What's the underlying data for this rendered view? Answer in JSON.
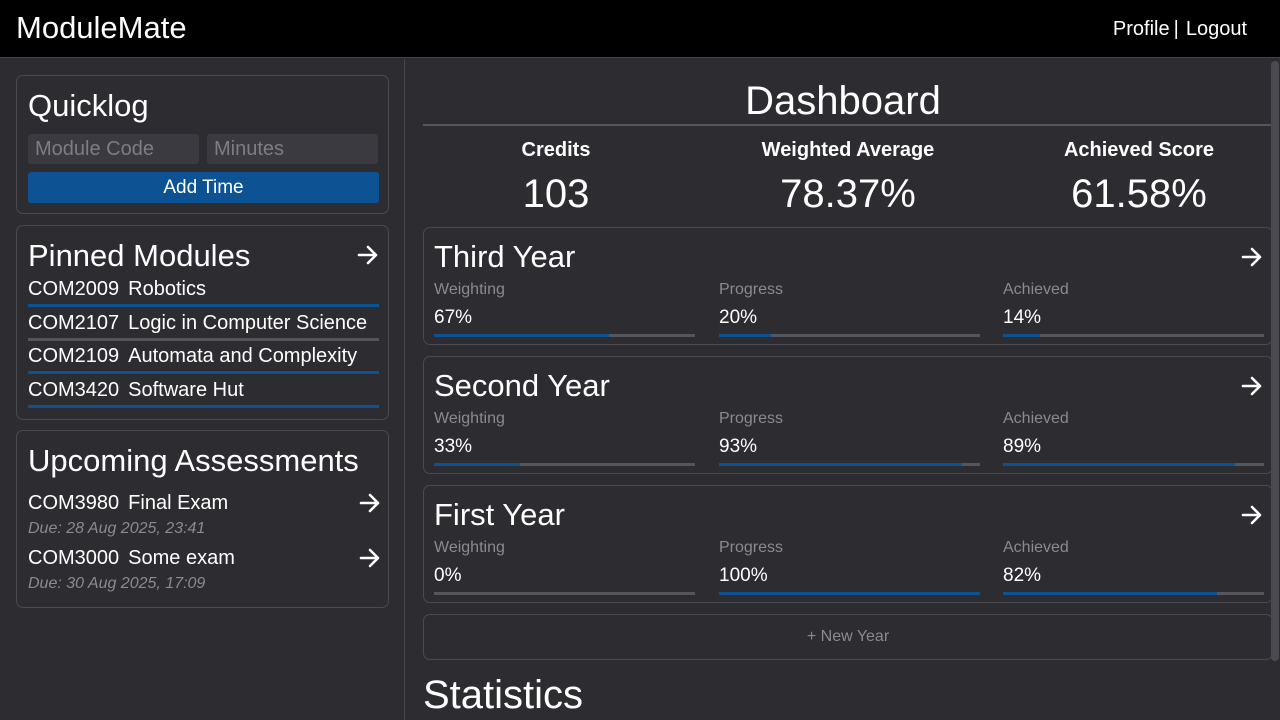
{
  "app": {
    "brand": "ModuleMate",
    "nav": {
      "profile": "Profile",
      "separator": "|",
      "logout": "Logout"
    }
  },
  "colors": {
    "accent": "#0d5394",
    "background": "#2c2c31",
    "topbar": "#000000",
    "track": "#55555b"
  },
  "quicklog": {
    "title": "Quicklog",
    "module_placeholder": "Module Code",
    "minutes_placeholder": "Minutes",
    "module_value": "",
    "minutes_value": "",
    "button": "Add Time"
  },
  "pinned": {
    "title": "Pinned Modules",
    "icon": "arrow-right-icon",
    "items": [
      {
        "code": "COM2009",
        "name": "Robotics",
        "progress": 1.0
      },
      {
        "code": "COM2107",
        "name": "Logic in Computer Science",
        "progress": 0.0
      },
      {
        "code": "COM2109",
        "name": "Automata and Complexity",
        "progress": 1.0
      },
      {
        "code": "COM3420",
        "name": "Software Hut",
        "progress": 1.0
      }
    ]
  },
  "upcoming": {
    "title": "Upcoming Assessments",
    "items": [
      {
        "code": "COM3980",
        "name": "Final Exam",
        "due": "Due: 28 Aug 2025, 23:41"
      },
      {
        "code": "COM3000",
        "name": "Some exam",
        "due": "Due: 30 Aug 2025, 17:09"
      }
    ]
  },
  "dashboard": {
    "title": "Dashboard",
    "stats": [
      {
        "label": "Credits",
        "value": "103"
      },
      {
        "label": "Weighted Average",
        "value": "78.37%"
      },
      {
        "label": "Achieved Score",
        "value": "61.58%"
      }
    ],
    "metric_labels": {
      "weighting": "Weighting",
      "progress": "Progress",
      "achieved": "Achieved"
    },
    "years": [
      {
        "title": "Third Year",
        "weighting": "67%",
        "weighting_pct": 67,
        "progress": "20%",
        "progress_pct": 20,
        "achieved": "14%",
        "achieved_pct": 14
      },
      {
        "title": "Second Year",
        "weighting": "33%",
        "weighting_pct": 33,
        "progress": "93%",
        "progress_pct": 93,
        "achieved": "89%",
        "achieved_pct": 89
      },
      {
        "title": "First Year",
        "weighting": "0%",
        "weighting_pct": 0,
        "progress": "100%",
        "progress_pct": 100,
        "achieved": "82%",
        "achieved_pct": 82
      }
    ],
    "new_year": "+ New Year",
    "statistics_title": "Statistics"
  }
}
